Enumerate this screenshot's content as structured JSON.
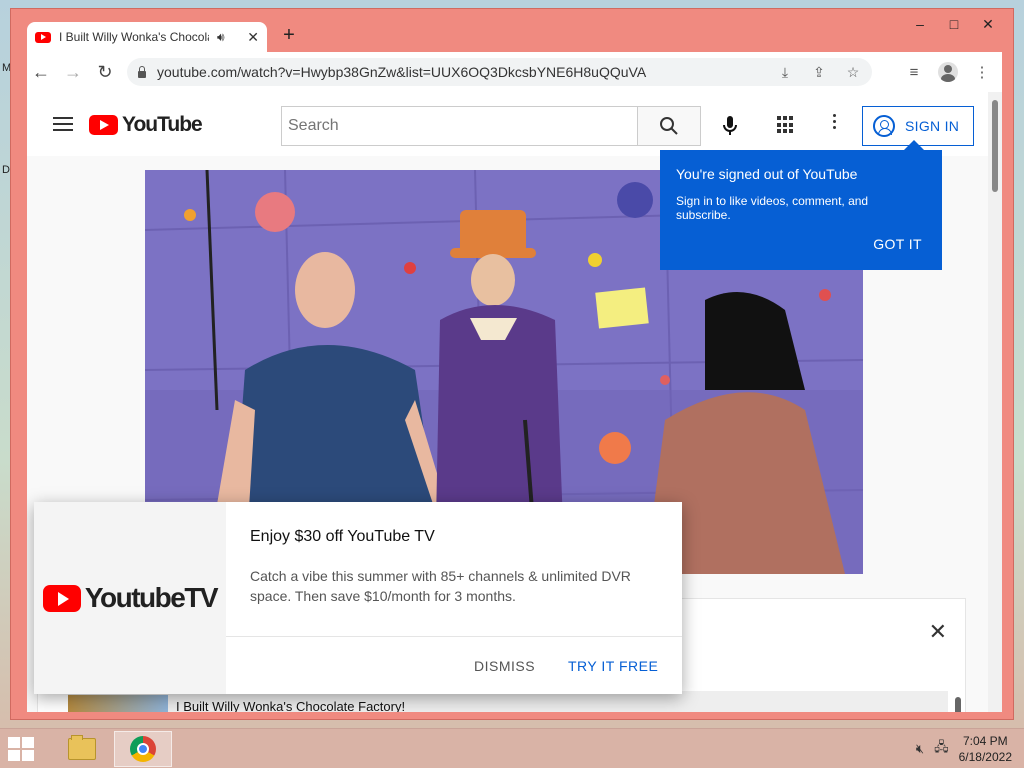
{
  "desktop": {
    "left_letters": [
      "M",
      "D"
    ]
  },
  "window": {
    "controls": {
      "minimize": "–",
      "maximize": "□",
      "close": "✕"
    }
  },
  "tab": {
    "title": "I Built Willy Wonka's Chocolate Factory!",
    "audio_icon": "speaker-icon",
    "close": "✕",
    "new_tab": "+"
  },
  "toolbar": {
    "back": "←",
    "forward": "→",
    "reload": "↻",
    "url": "youtube.com/watch?v=Hwybp38GnZw&list=UUX6OQ3DkcsbYNE6H8uQQuVA",
    "icons": [
      "install-icon",
      "share-icon",
      "bookmark-star-icon",
      "reading-list-icon",
      "profile-icon",
      "menu-icon"
    ]
  },
  "youtube": {
    "logo_text": "YouTube",
    "search_placeholder": "Search",
    "sign_in": "SIGN IN"
  },
  "tooltip": {
    "title": "You're signed out of YouTube",
    "body": "Sign in to like videos, comment, and subscribe.",
    "action": "GOT IT"
  },
  "promo": {
    "logo_text": "YoutubeTV",
    "title": "Enjoy $30 off YouTube TV",
    "body": "Catch a vibe this summer with 85+ channels & unlimited DVR space. Then save $10/month for 3 months.",
    "dismiss": "DISMISS",
    "try": "TRY IT FREE"
  },
  "panel": {
    "close": "✕",
    "playlist_item": "I Built Willy Wonka's Chocolate Factory!"
  },
  "taskbar": {
    "time": "7:04 PM",
    "date": "6/18/2022"
  },
  "colors": {
    "accent": "#065fd4",
    "brand_red": "#ff0000",
    "frame": "#f08a80"
  }
}
